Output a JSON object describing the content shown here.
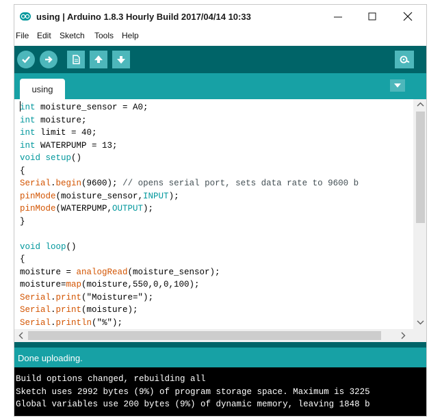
{
  "window": {
    "title": "using | Arduino 1.8.3 Hourly Build 2017/04/14 10:33"
  },
  "menu": {
    "items": [
      "File",
      "Edit",
      "Sketch",
      "Tools",
      "Help"
    ]
  },
  "toolbar": {
    "buttons": [
      "verify-icon",
      "upload-icon",
      "new-icon",
      "open-icon",
      "save-icon"
    ],
    "serial_monitor": "serial-monitor-icon"
  },
  "tabs": {
    "active": "using"
  },
  "editor": {
    "lines": [
      [
        {
          "t": "int",
          "c": "kw"
        },
        {
          "t": " moisture_sensor = A0;",
          "c": ""
        }
      ],
      [
        {
          "t": "int",
          "c": "kw"
        },
        {
          "t": " moisture;",
          "c": ""
        }
      ],
      [
        {
          "t": "int",
          "c": "kw"
        },
        {
          "t": " limit = 40;",
          "c": ""
        }
      ],
      [
        {
          "t": "int",
          "c": "kw"
        },
        {
          "t": " WATERPUMP = 13;",
          "c": ""
        }
      ],
      [
        {
          "t": "void",
          "c": "kw"
        },
        {
          "t": " ",
          "c": ""
        },
        {
          "t": "setup",
          "c": "kw"
        },
        {
          "t": "()",
          "c": ""
        }
      ],
      [
        {
          "t": "{",
          "c": ""
        }
      ],
      [
        {
          "t": "Serial",
          "c": "fn"
        },
        {
          "t": ".",
          "c": ""
        },
        {
          "t": "begin",
          "c": "fn"
        },
        {
          "t": "(9600); ",
          "c": ""
        },
        {
          "t": "// opens serial port, sets data rate to 9600 b",
          "c": "cm"
        }
      ],
      [
        {
          "t": "pinMode",
          "c": "fn"
        },
        {
          "t": "(moisture_sensor,",
          "c": ""
        },
        {
          "t": "INPUT",
          "c": "kw"
        },
        {
          "t": ");",
          "c": ""
        }
      ],
      [
        {
          "t": "pinMode",
          "c": "fn"
        },
        {
          "t": "(WATERPUMP,",
          "c": ""
        },
        {
          "t": "OUTPUT",
          "c": "kw"
        },
        {
          "t": ");",
          "c": ""
        }
      ],
      [
        {
          "t": "}",
          "c": ""
        }
      ],
      [
        {
          "t": "",
          "c": ""
        }
      ],
      [
        {
          "t": "void",
          "c": "kw"
        },
        {
          "t": " ",
          "c": ""
        },
        {
          "t": "loop",
          "c": "kw"
        },
        {
          "t": "()",
          "c": ""
        }
      ],
      [
        {
          "t": "{",
          "c": ""
        }
      ],
      [
        {
          "t": "moisture = ",
          "c": ""
        },
        {
          "t": "analogRead",
          "c": "fn"
        },
        {
          "t": "(moisture_sensor);",
          "c": ""
        }
      ],
      [
        {
          "t": "moisture=",
          "c": ""
        },
        {
          "t": "map",
          "c": "fn"
        },
        {
          "t": "(moisture,550,0,0,100);",
          "c": ""
        }
      ],
      [
        {
          "t": "Serial",
          "c": "fn"
        },
        {
          "t": ".",
          "c": ""
        },
        {
          "t": "print",
          "c": "fn"
        },
        {
          "t": "(\"Moisture=\");",
          "c": ""
        }
      ],
      [
        {
          "t": "Serial",
          "c": "fn"
        },
        {
          "t": ".",
          "c": ""
        },
        {
          "t": "print",
          "c": "fn"
        },
        {
          "t": "(moisture);",
          "c": ""
        }
      ],
      [
        {
          "t": "Serial",
          "c": "fn"
        },
        {
          "t": ".",
          "c": ""
        },
        {
          "t": "println",
          "c": "fn"
        },
        {
          "t": "(\"%\");",
          "c": ""
        }
      ]
    ]
  },
  "status": {
    "text": "Done uploading."
  },
  "console": {
    "lines": [
      "Build options changed, rebuilding all",
      "Sketch uses 2992 bytes (9%) of program storage space. Maximum is 3225",
      "Global variables use 200 bytes (9%) of dynamic memory, leaving 1848 b"
    ]
  },
  "colors": {
    "toolbar": "#006468",
    "tabs": "#17a1a5",
    "button": "#4db7bb",
    "keyword": "#00979c",
    "function": "#d35400"
  }
}
